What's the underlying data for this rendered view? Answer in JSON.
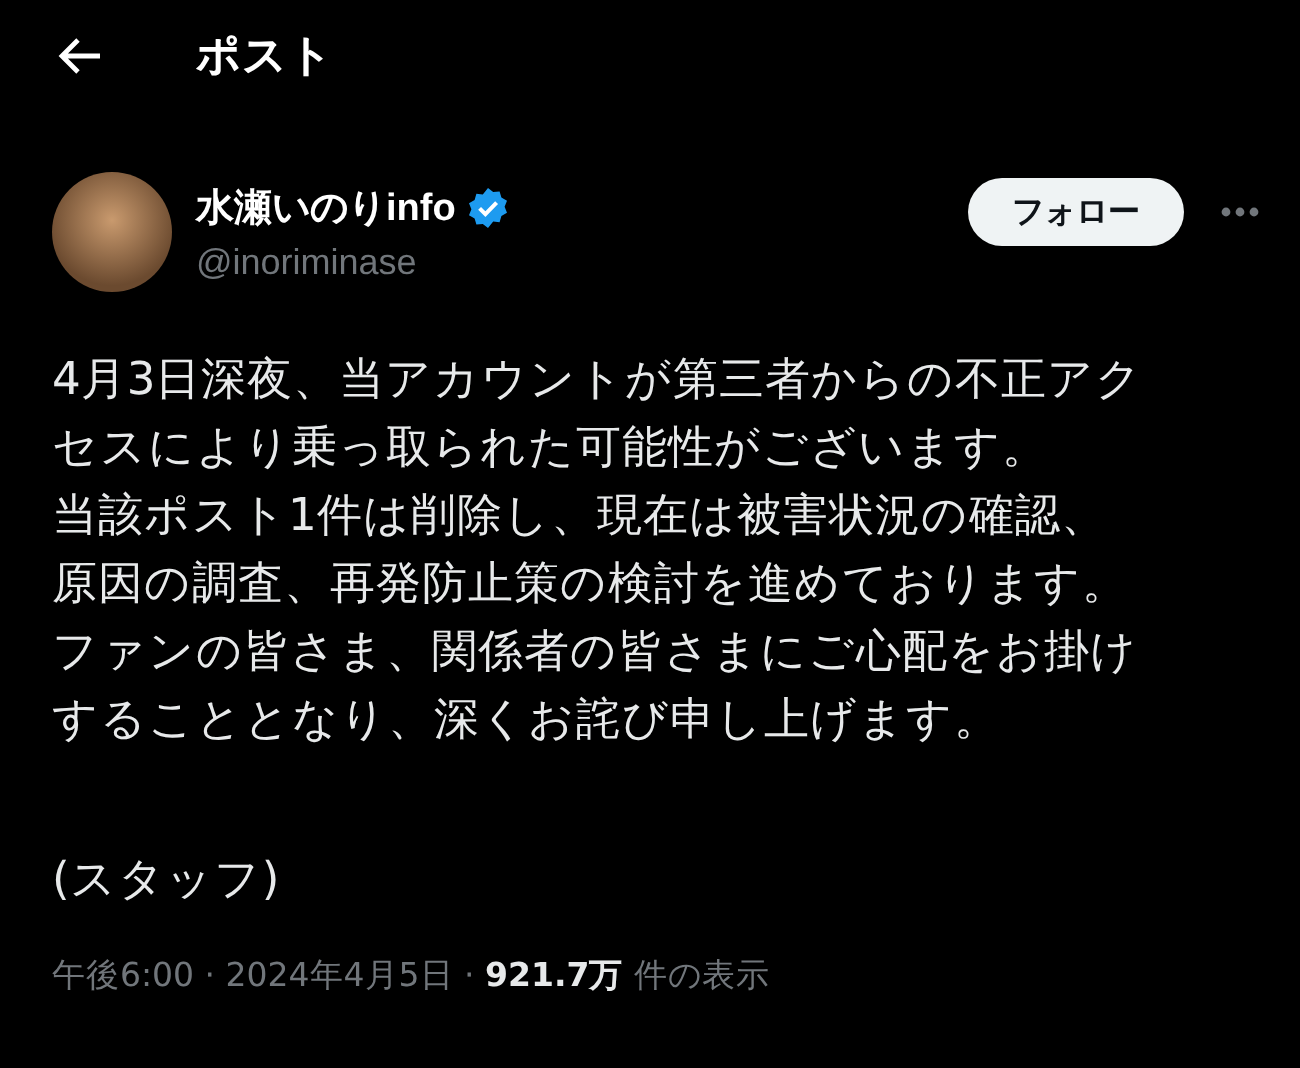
{
  "header": {
    "title": "ポスト"
  },
  "author": {
    "name": "水瀬いのりinfo",
    "verified": true,
    "handle": "@inoriminase"
  },
  "follow_button": "フォロー",
  "body_lines": [
    "4月3日深夜、当アカウントが第三者からの不正アク",
    "セスにより乗っ取られた可能性がございます。",
    "当該ポスト1件は削除し、現在は被害状況の確認、",
    "原因の調査、再発防止策の検討を進めております。",
    "ファンの皆さま、関係者の皆さまにご心配をお掛け",
    "することとなり、深くお詫び申し上げます。"
  ],
  "signature": "(スタッフ)",
  "meta": "午後6:00 · 2024年4月5日 · **921.7万** 件の表示"
}
